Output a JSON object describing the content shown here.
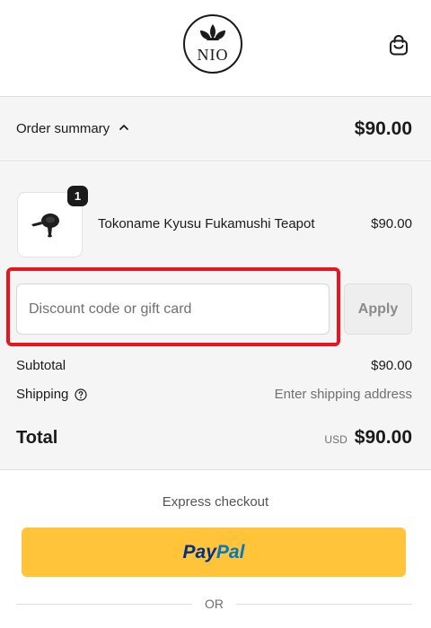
{
  "header": {
    "logo_text": "NIO",
    "cart_icon": "shopping-bag-icon"
  },
  "summary": {
    "toggle_label": "Order summary",
    "toggle_icon": "chevron-up-icon",
    "total": "$90.00"
  },
  "line_items": [
    {
      "quantity": "1",
      "name": "Tokoname Kyusu Fukamushi Teapot",
      "price": "$90.00",
      "image_icon": "teapot-icon"
    }
  ],
  "discount": {
    "placeholder": "Discount code or gift card",
    "value": "",
    "apply_label": "Apply"
  },
  "totals": {
    "subtotal_label": "Subtotal",
    "subtotal_value": "$90.00",
    "shipping_label": "Shipping",
    "shipping_help_icon": "help-circle-icon",
    "shipping_value": "Enter shipping address",
    "total_label": "Total",
    "currency": "USD",
    "total_value": "$90.00"
  },
  "express": {
    "label": "Express checkout",
    "paypal_part1": "Pay",
    "paypal_part2": "Pal",
    "or_label": "OR"
  },
  "colors": {
    "paypal_yellow": "#ffc439",
    "paypal_dark_blue": "#003087",
    "paypal_light_blue": "#0079c1",
    "highlight_red": "#e8141f",
    "summary_background": "#f5f5f5"
  }
}
